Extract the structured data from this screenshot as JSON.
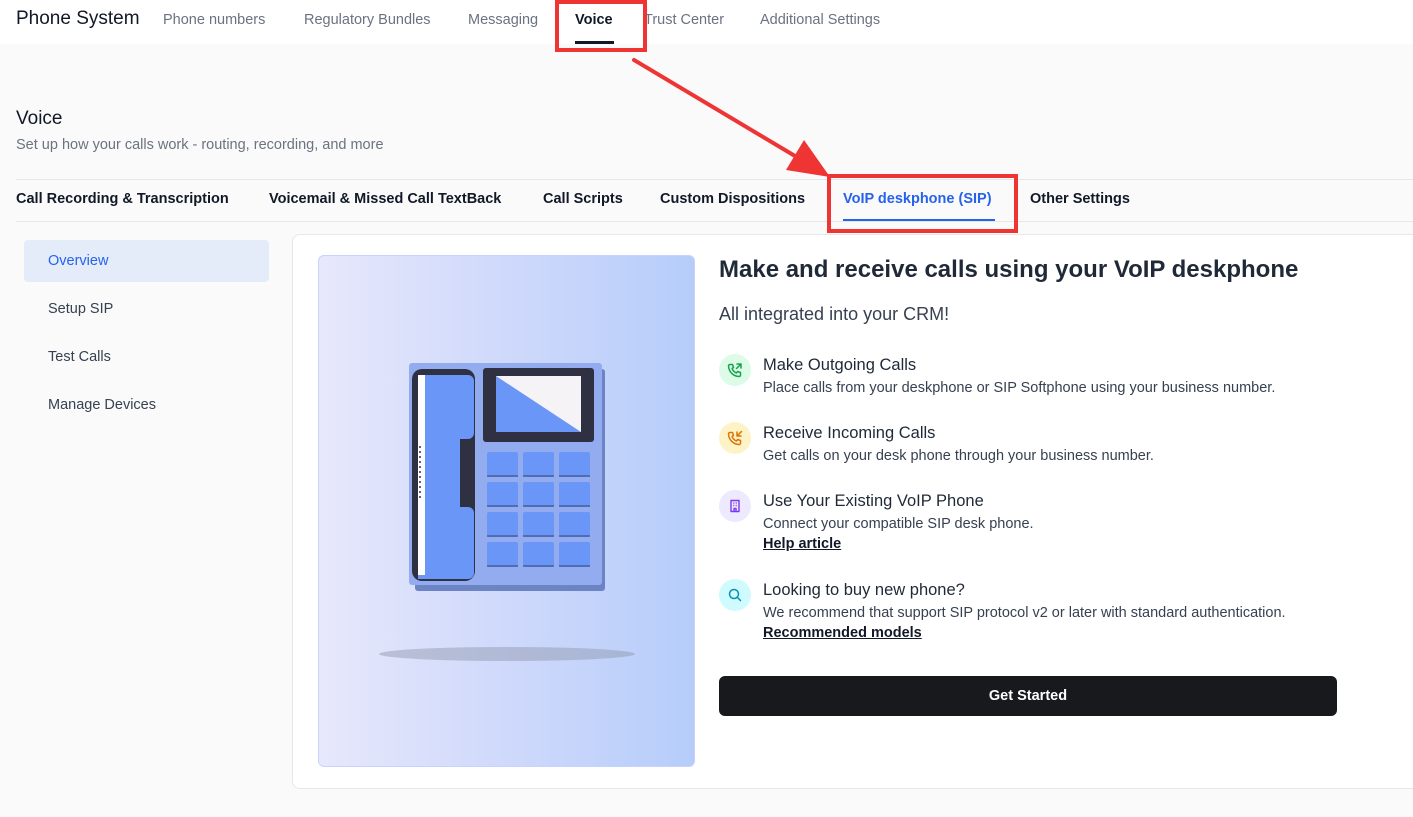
{
  "topnav": {
    "app_title": "Phone System",
    "items": [
      {
        "label": "Phone numbers"
      },
      {
        "label": "Regulatory Bundles"
      },
      {
        "label": "Messaging"
      },
      {
        "label": "Voice"
      },
      {
        "label": "Trust Center"
      },
      {
        "label": "Additional Settings"
      }
    ],
    "active": "Voice"
  },
  "page": {
    "title": "Voice",
    "subtitle": "Set up how your calls work - routing, recording, and more"
  },
  "subtabs": {
    "items": [
      {
        "label": "Call Recording & Transcription"
      },
      {
        "label": "Voicemail & Missed Call TextBack"
      },
      {
        "label": "Call Scripts"
      },
      {
        "label": "Custom Dispositions"
      },
      {
        "label": "VoIP deskphone (SIP)"
      },
      {
        "label": "Other Settings"
      }
    ],
    "active": "VoIP deskphone (SIP)"
  },
  "sidebar": {
    "items": [
      {
        "label": "Overview"
      },
      {
        "label": "Setup SIP"
      },
      {
        "label": "Test Calls"
      },
      {
        "label": "Manage Devices"
      }
    ],
    "active": "Overview"
  },
  "main": {
    "heading": "Make and receive calls using your VoIP deskphone",
    "subheading": "All integrated into your CRM!",
    "features": [
      {
        "icon": "phone-outgoing-icon",
        "title": "Make Outgoing Calls",
        "description": "Place calls from your deskphone or SIP Softphone using your business number."
      },
      {
        "icon": "phone-incoming-icon",
        "title": "Receive Incoming Calls",
        "description": "Get calls on your desk phone through your business number."
      },
      {
        "icon": "building-icon",
        "title": "Use Your Existing VoIP Phone",
        "description": "Connect your compatible SIP desk phone.",
        "link": "Help article"
      },
      {
        "icon": "search-icon",
        "title": "Looking to buy new phone?",
        "description": "We recommend that support SIP protocol v2 or later with standard authentication.",
        "link": "Recommended models"
      }
    ],
    "cta_label": "Get Started"
  },
  "colors": {
    "accent": "#2563eb",
    "annotation": "#ef3434",
    "button_bg": "#17191c"
  }
}
